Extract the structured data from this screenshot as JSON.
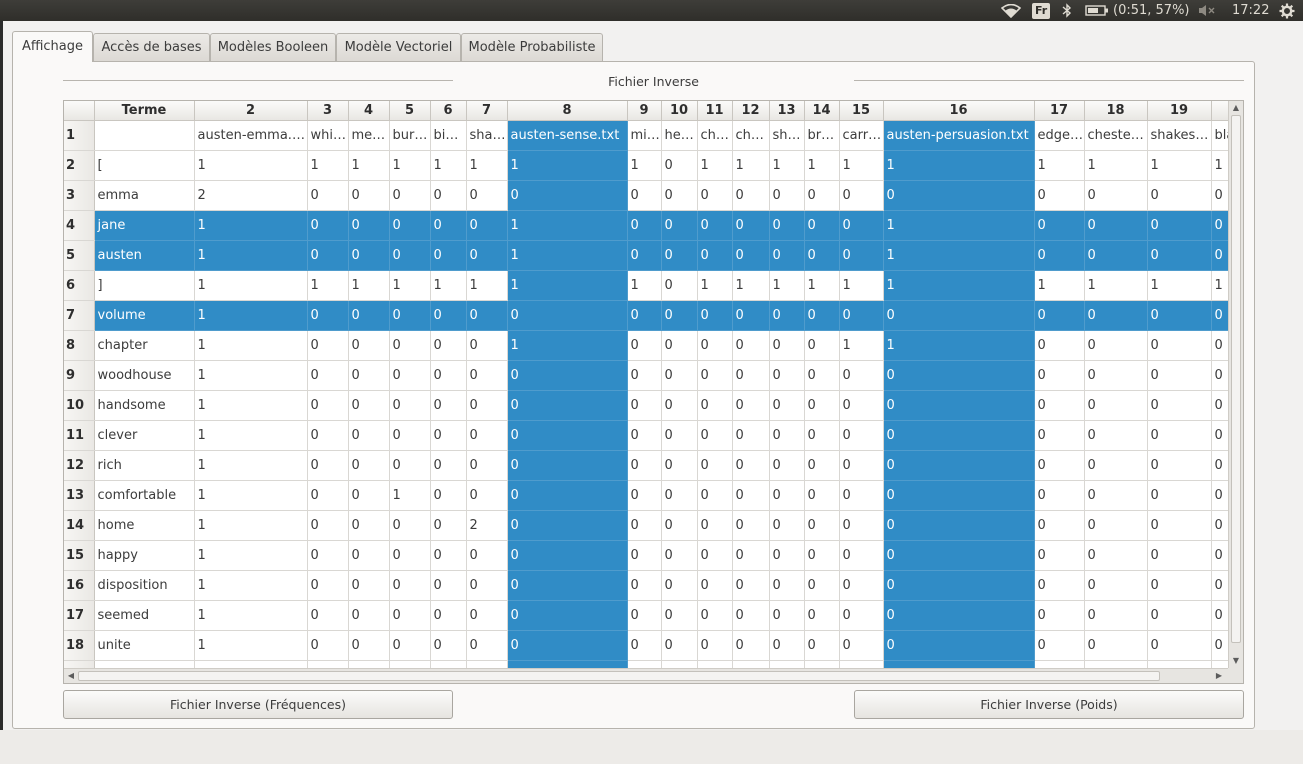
{
  "topbar": {
    "lang": "Fr",
    "battery": "(0:51, 57%)",
    "time": "17:22",
    "icons": [
      "wifi-icon",
      "bluetooth-icon",
      "battery-icon",
      "volume-muted-icon",
      "settings-gear-icon"
    ]
  },
  "tabs": [
    {
      "label": "Affichage",
      "active": true
    },
    {
      "label": "Accès de bases",
      "active": false
    },
    {
      "label": "Modèles Booleen",
      "active": false
    },
    {
      "label": "Modèle Vectoriel",
      "active": false
    },
    {
      "label": "Modèle Probabiliste",
      "active": false
    }
  ],
  "group_title": "Fichier Inverse",
  "table": {
    "columns": [
      "Terme",
      "2",
      "3",
      "4",
      "5",
      "6",
      "7",
      "8",
      "9",
      "10",
      "11",
      "12",
      "13",
      "14",
      "15",
      "16",
      "17",
      "18",
      "19",
      ""
    ],
    "selected_columns": [
      7,
      15
    ],
    "selected_rows": [
      3,
      4,
      6
    ],
    "rows": [
      {
        "num": "1",
        "cells": [
          "",
          "austen-emma.txt",
          "whi…",
          "me…",
          "bur…",
          "bi…",
          "sha…",
          "austen-sense.txt",
          "mi…",
          "he…",
          "ch…",
          "ch…",
          "sh…",
          "br…",
          "carr…",
          "austen-persuasion.txt",
          "edge…",
          "cheste…",
          "shakes…",
          "bla"
        ]
      },
      {
        "num": "2",
        "cells": [
          "[",
          "1",
          "1",
          "1",
          "1",
          "1",
          "1",
          "1",
          "1",
          "0",
          "1",
          "1",
          "1",
          "1",
          "1",
          "1",
          "1",
          "1",
          "1",
          "1"
        ]
      },
      {
        "num": "3",
        "cells": [
          "emma",
          "2",
          "0",
          "0",
          "0",
          "0",
          "0",
          "0",
          "0",
          "0",
          "0",
          "0",
          "0",
          "0",
          "0",
          "0",
          "0",
          "0",
          "0",
          "0"
        ]
      },
      {
        "num": "4",
        "cells": [
          "jane",
          "1",
          "0",
          "0",
          "0",
          "0",
          "0",
          "1",
          "0",
          "0",
          "0",
          "0",
          "0",
          "0",
          "0",
          "1",
          "0",
          "0",
          "0",
          "0"
        ]
      },
      {
        "num": "5",
        "cells": [
          "austen",
          "1",
          "0",
          "0",
          "0",
          "0",
          "0",
          "1",
          "0",
          "0",
          "0",
          "0",
          "0",
          "0",
          "0",
          "1",
          "0",
          "0",
          "0",
          "0"
        ]
      },
      {
        "num": "6",
        "cells": [
          "]",
          "1",
          "1",
          "1",
          "1",
          "1",
          "1",
          "1",
          "1",
          "0",
          "1",
          "1",
          "1",
          "1",
          "1",
          "1",
          "1",
          "1",
          "1",
          "1"
        ]
      },
      {
        "num": "7",
        "cells": [
          "volume",
          "1",
          "0",
          "0",
          "0",
          "0",
          "0",
          "0",
          "0",
          "0",
          "0",
          "0",
          "0",
          "0",
          "0",
          "0",
          "0",
          "0",
          "0",
          "0"
        ]
      },
      {
        "num": "8",
        "cells": [
          "chapter",
          "1",
          "0",
          "0",
          "0",
          "0",
          "0",
          "1",
          "0",
          "0",
          "0",
          "0",
          "0",
          "0",
          "1",
          "1",
          "0",
          "0",
          "0",
          "0"
        ]
      },
      {
        "num": "9",
        "cells": [
          "woodhouse",
          "1",
          "0",
          "0",
          "0",
          "0",
          "0",
          "0",
          "0",
          "0",
          "0",
          "0",
          "0",
          "0",
          "0",
          "0",
          "0",
          "0",
          "0",
          "0"
        ]
      },
      {
        "num": "10",
        "cells": [
          "handsome",
          "1",
          "0",
          "0",
          "0",
          "0",
          "0",
          "0",
          "0",
          "0",
          "0",
          "0",
          "0",
          "0",
          "0",
          "0",
          "0",
          "0",
          "0",
          "0"
        ]
      },
      {
        "num": "11",
        "cells": [
          "clever",
          "1",
          "0",
          "0",
          "0",
          "0",
          "0",
          "0",
          "0",
          "0",
          "0",
          "0",
          "0",
          "0",
          "0",
          "0",
          "0",
          "0",
          "0",
          "0"
        ]
      },
      {
        "num": "12",
        "cells": [
          "rich",
          "1",
          "0",
          "0",
          "0",
          "0",
          "0",
          "0",
          "0",
          "0",
          "0",
          "0",
          "0",
          "0",
          "0",
          "0",
          "0",
          "0",
          "0",
          "0"
        ]
      },
      {
        "num": "13",
        "cells": [
          "comfortable",
          "1",
          "0",
          "0",
          "1",
          "0",
          "0",
          "0",
          "0",
          "0",
          "0",
          "0",
          "0",
          "0",
          "0",
          "0",
          "0",
          "0",
          "0",
          "0"
        ]
      },
      {
        "num": "14",
        "cells": [
          "home",
          "1",
          "0",
          "0",
          "0",
          "0",
          "2",
          "0",
          "0",
          "0",
          "0",
          "0",
          "0",
          "0",
          "0",
          "0",
          "0",
          "0",
          "0",
          "0"
        ]
      },
      {
        "num": "15",
        "cells": [
          "happy",
          "1",
          "0",
          "0",
          "0",
          "0",
          "0",
          "0",
          "0",
          "0",
          "0",
          "0",
          "0",
          "0",
          "0",
          "0",
          "0",
          "0",
          "0",
          "0"
        ]
      },
      {
        "num": "16",
        "cells": [
          "disposition",
          "1",
          "0",
          "0",
          "0",
          "0",
          "0",
          "0",
          "0",
          "0",
          "0",
          "0",
          "0",
          "0",
          "0",
          "0",
          "0",
          "0",
          "0",
          "0"
        ]
      },
      {
        "num": "17",
        "cells": [
          "seemed",
          "1",
          "0",
          "0",
          "0",
          "0",
          "0",
          "0",
          "0",
          "0",
          "0",
          "0",
          "0",
          "0",
          "0",
          "0",
          "0",
          "0",
          "0",
          "0"
        ]
      },
      {
        "num": "18",
        "cells": [
          "unite",
          "1",
          "0",
          "0",
          "0",
          "0",
          "0",
          "0",
          "0",
          "0",
          "0",
          "0",
          "0",
          "0",
          "0",
          "0",
          "0",
          "0",
          "0",
          "0"
        ]
      },
      {
        "num": "",
        "cells": [
          "",
          "",
          "",
          "",
          "",
          "",
          "",
          "",
          "",
          "",
          "",
          "",
          "",
          "",
          "",
          "",
          "",
          "",
          "",
          ""
        ]
      }
    ]
  },
  "buttons": {
    "freq": "Fichier Inverse (Fréquences)",
    "poids": "Fichier Inverse (Poids)"
  }
}
